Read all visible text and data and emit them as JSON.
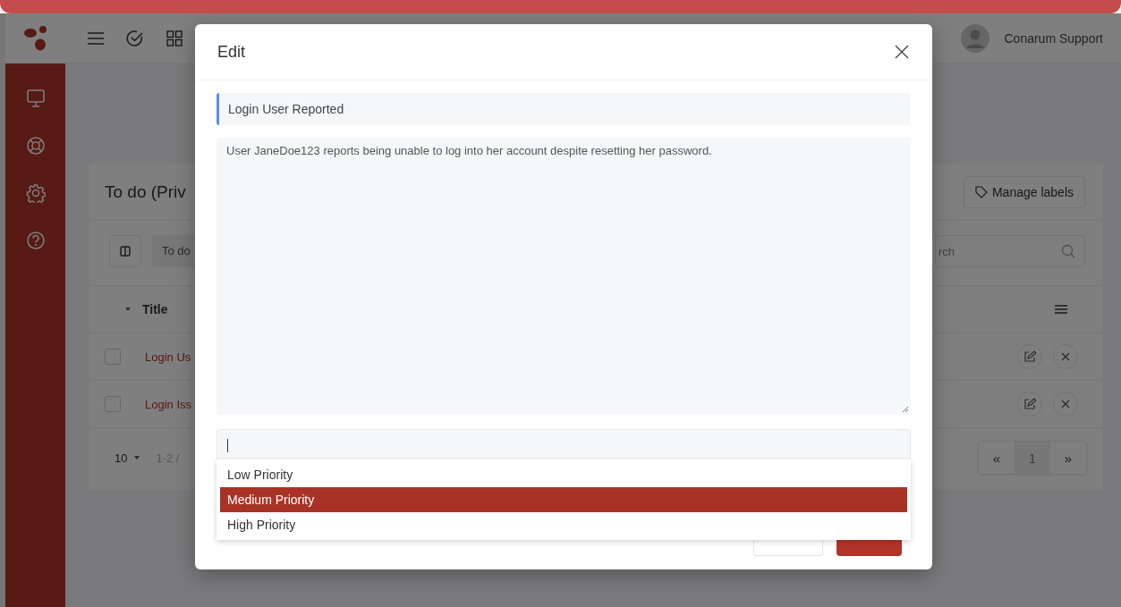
{
  "header": {
    "user_name": "Conarum Support"
  },
  "card": {
    "title": "To do (Priv",
    "manage_labels": "Manage labels",
    "list_select": "To do",
    "search_placeholder": "rch",
    "columns": [
      {
        "label": "Title"
      }
    ],
    "rows": [
      {
        "title": "Login Us",
        "checked": false
      },
      {
        "title": "Login Iss",
        "checked": false
      }
    ],
    "page_size": "10",
    "range": "1-2 /",
    "pages": [
      {
        "label": "«",
        "selected": false
      },
      {
        "label": "1",
        "selected": true
      },
      {
        "label": "»",
        "selected": false
      }
    ]
  },
  "modal": {
    "title": "Edit",
    "subject": "Login User Reported",
    "description": "User JaneDoe123 reports being unable to log into her account despite resetting her password.",
    "options": [
      {
        "label": "Low Priority",
        "selected": false
      },
      {
        "label": "Medium Priority",
        "selected": true
      },
      {
        "label": "High Priority",
        "selected": false
      }
    ]
  }
}
